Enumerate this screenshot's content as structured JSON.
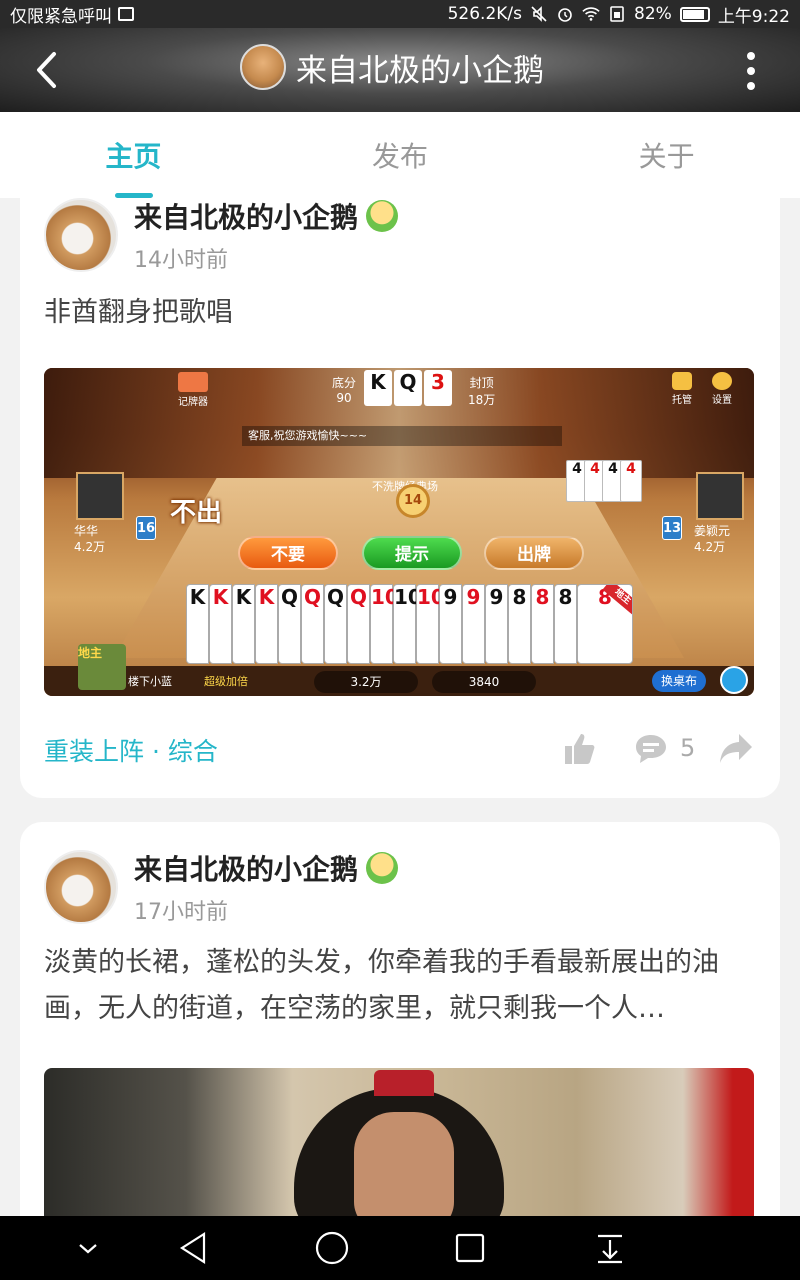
{
  "status_bar": {
    "carrier": "仅限紧急呼叫",
    "net_speed": "526.2K/s",
    "battery": "82%",
    "time": "上午9:22",
    "icons": [
      "image-icon",
      "mute-icon",
      "alarm-icon",
      "wifi-icon",
      "sim-icon",
      "battery-icon"
    ]
  },
  "header": {
    "title": "来自北极的小企鹅",
    "back_icon": "back-arrow-icon",
    "more_icon": "more-vertical-icon"
  },
  "tabs": [
    {
      "label": "主页",
      "active": true
    },
    {
      "label": "发布",
      "active": false
    },
    {
      "label": "关于",
      "active": false
    }
  ],
  "accent_color": "#25b6c9",
  "posts": [
    {
      "author": "来自北极的小企鹅",
      "time": "14小时前",
      "text": "非酋翻身把歌唱",
      "category": "重装上阵 · 综合",
      "comments": "5",
      "game": {
        "base_score_label": "底分",
        "base_score": "90",
        "cap_label": "封顶",
        "cap": "18万",
        "top_cards": [
          "K",
          "Q",
          "3"
        ],
        "card_counter": "记牌器",
        "trustee": "托管",
        "settings": "设置",
        "chat_message": "客服,祝您游戏愉快~~~",
        "status_message": "不洗牌经典场",
        "timer": "14",
        "pass_text": "不出",
        "buttons": [
          "不要",
          "提示",
          "出牌"
        ],
        "hand": [
          "K",
          "K",
          "K",
          "K",
          "Q",
          "Q",
          "Q",
          "Q",
          "10",
          "10",
          "10",
          "9",
          "9",
          "9",
          "8",
          "8",
          "8",
          "8"
        ],
        "hand_red": [
          false,
          true,
          false,
          true,
          false,
          true,
          false,
          true,
          true,
          false,
          true,
          false,
          true,
          false,
          false,
          true,
          false,
          true
        ],
        "right_cards": [
          "4",
          "4",
          "4",
          "4"
        ],
        "left_player": {
          "name": "华华",
          "coins": "4.2万",
          "cards": "16"
        },
        "right_player": {
          "name": "姜颖元",
          "coins": "4.2万",
          "cards": "13"
        },
        "landlord_label": "地主",
        "self_name": "楼下小蓝",
        "multiplier": "超级加倍",
        "self_coins": "3.2万",
        "score": "3840",
        "change_table": "换桌布"
      }
    },
    {
      "author": "来自北极的小企鹅",
      "time": "17小时前",
      "text": "淡黄的长裙，蓬松的头发，你牵着我的手看最新展出的油画，无人的街道，在空荡的家里，就只剩我一个人…"
    }
  ]
}
